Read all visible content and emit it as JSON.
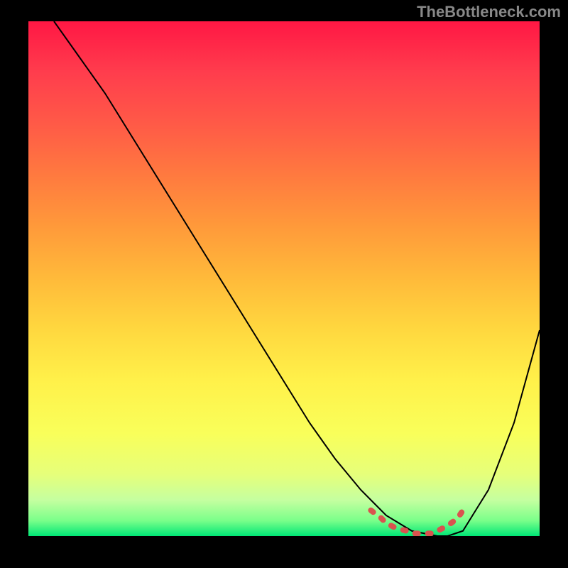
{
  "watermark": "TheBottleneck.com",
  "chart_data": {
    "type": "line",
    "title": "",
    "xlabel": "",
    "ylabel": "",
    "xlim": [
      0,
      100
    ],
    "ylim": [
      0,
      100
    ],
    "gradient_stops": [
      {
        "pos": 0,
        "color": "#ff1744"
      },
      {
        "pos": 10,
        "color": "#ff3d4d"
      },
      {
        "pos": 20,
        "color": "#ff5a47"
      },
      {
        "pos": 30,
        "color": "#ff7a3f"
      },
      {
        "pos": 40,
        "color": "#ff9a3a"
      },
      {
        "pos": 50,
        "color": "#ffba3a"
      },
      {
        "pos": 60,
        "color": "#ffd83f"
      },
      {
        "pos": 70,
        "color": "#fff14a"
      },
      {
        "pos": 80,
        "color": "#f9ff5a"
      },
      {
        "pos": 88,
        "color": "#e6ff7a"
      },
      {
        "pos": 93,
        "color": "#c5ffa0"
      },
      {
        "pos": 97,
        "color": "#7aff8a"
      },
      {
        "pos": 100,
        "color": "#00e676"
      }
    ],
    "series": [
      {
        "name": "bottleneck-curve",
        "color": "#000000",
        "x": [
          5,
          10,
          15,
          20,
          25,
          30,
          35,
          40,
          45,
          50,
          55,
          60,
          65,
          70,
          75,
          80,
          82,
          85,
          90,
          95,
          100
        ],
        "y": [
          100,
          93,
          86,
          78,
          70,
          62,
          54,
          46,
          38,
          30,
          22,
          15,
          9,
          4,
          1,
          0,
          0,
          1,
          9,
          22,
          40
        ]
      }
    ],
    "markers": {
      "name": "highlighted-segment",
      "color": "#d9534f",
      "x": [
        67,
        69,
        70,
        72,
        74,
        75,
        77,
        79,
        80,
        82,
        84,
        85
      ],
      "y": [
        5,
        3.5,
        2.5,
        1.5,
        1,
        0.5,
        0.5,
        0.5,
        1,
        2,
        3.5,
        5
      ]
    }
  }
}
